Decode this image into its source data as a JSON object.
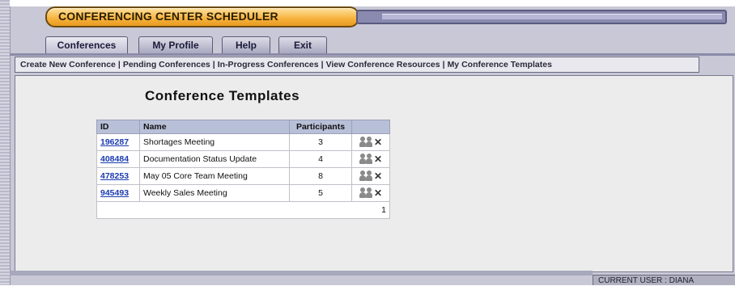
{
  "app": {
    "title": "CONFERENCING CENTER SCHEDULER"
  },
  "tabs": [
    {
      "label": "Conferences",
      "active": true
    },
    {
      "label": "My Profile",
      "active": false
    },
    {
      "label": "Help",
      "active": false
    },
    {
      "label": "Exit",
      "active": false
    }
  ],
  "menu": [
    "Create New Conference",
    "Pending Conferences",
    "In-Progress Conferences",
    "View Conference Resources",
    "My Conference Templates"
  ],
  "page": {
    "title": "Conference Templates"
  },
  "table": {
    "headers": [
      "ID",
      "Name",
      "Participants",
      ""
    ],
    "rows": [
      {
        "id": "196287",
        "name": "Shortages Meeting",
        "participants": "3",
        "action_icon": "remove-participants-icon"
      },
      {
        "id": "408484",
        "name": "Documentation Status Update",
        "participants": "4",
        "action_icon": "remove-participants-icon"
      },
      {
        "id": "478253",
        "name": "May 05 Core Team Meeting",
        "participants": "8",
        "action_icon": "remove-participants-icon"
      },
      {
        "id": "945493",
        "name": "Weekly Sales Meeting",
        "participants": "5",
        "action_icon": "remove-participants-icon"
      }
    ],
    "page_number": "1"
  },
  "status": {
    "current_user": "CURRENT USER : DIANA"
  },
  "colors": {
    "title_pill": "#f6b23c",
    "frame": "#c8c8d6",
    "table_header": "#b8c0d8",
    "link": "#1a3ab0"
  }
}
